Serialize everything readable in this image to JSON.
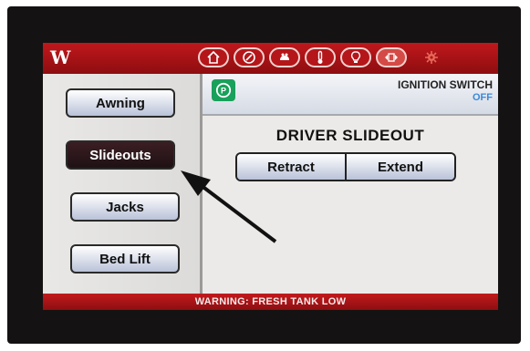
{
  "brand": {
    "logo_text": "W"
  },
  "nav_icons": [
    "home-icon",
    "dashboard-icon",
    "climate-icon",
    "thermometer-icon",
    "light-bulb-icon",
    "slideout-icon",
    "settings-icon"
  ],
  "sidebar": {
    "items": [
      {
        "label": "Awning",
        "selected": false
      },
      {
        "label": "Slideouts",
        "selected": true
      },
      {
        "label": "Jacks",
        "selected": false
      },
      {
        "label": "Bed Lift",
        "selected": false
      }
    ]
  },
  "status": {
    "ignition_label": "IGNITION SWITCH",
    "ignition_state": "OFF",
    "park_icon": "parking-brake-icon"
  },
  "main": {
    "title": "DRIVER SLIDEOUT",
    "retract_label": "Retract",
    "extend_label": "Extend"
  },
  "warning": {
    "text": "WARNING: FRESH TANK LOW"
  },
  "colors": {
    "header_red": "#b4161a",
    "warning_red": "#c21a1d",
    "ignition_off_blue": "#3b88d9",
    "park_green": "#19a05a",
    "selected_button": "#2a161a"
  }
}
